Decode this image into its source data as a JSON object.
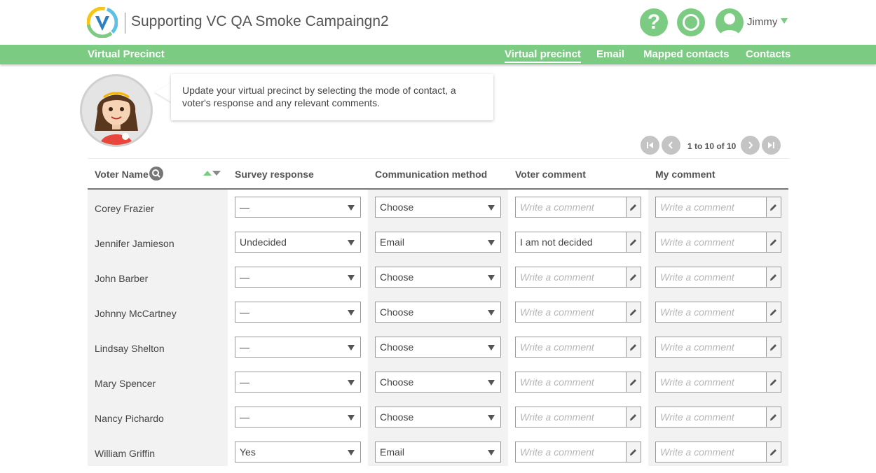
{
  "header": {
    "title": "Supporting VC QA Smoke Campaingn2",
    "help_symbol": "?",
    "user_name": "Jimmy",
    "logo_icon": "v-logo-icon",
    "colors": {
      "accent": "#7ccb83",
      "text": "#555555"
    }
  },
  "nav": {
    "brand": "Virtual Precinct",
    "links": [
      {
        "label": "Virtual precinct",
        "active": true
      },
      {
        "label": "Email",
        "active": false
      },
      {
        "label": "Mapped contacts",
        "active": false
      },
      {
        "label": "Contacts",
        "active": false
      }
    ]
  },
  "tip": {
    "text": "Update your virtual precinct by selecting the mode of contact, a voter's response and any relevant comments."
  },
  "pagination": {
    "summary": "1 to 10 of 10",
    "buttons": [
      "first-page-icon",
      "prev-page-icon",
      "next-page-icon",
      "last-page-icon"
    ]
  },
  "table": {
    "columns": [
      "Voter Name",
      "Survey response",
      "Communication method",
      "Voter comment",
      "My comment"
    ],
    "comment_placeholder": "Write a comment",
    "rows": [
      {
        "name": "Corey Frazier",
        "survey": "—",
        "method": "Choose",
        "voter_comment": "",
        "my_comment": ""
      },
      {
        "name": "Jennifer Jamieson",
        "survey": "Undecided",
        "method": "Email",
        "voter_comment": "I am not decided",
        "my_comment": ""
      },
      {
        "name": "John Barber",
        "survey": "—",
        "method": "Choose",
        "voter_comment": "",
        "my_comment": ""
      },
      {
        "name": "Johnny McCartney",
        "survey": "—",
        "method": "Choose",
        "voter_comment": "",
        "my_comment": ""
      },
      {
        "name": "Lindsay Shelton",
        "survey": "—",
        "method": "Choose",
        "voter_comment": "",
        "my_comment": ""
      },
      {
        "name": "Mary Spencer",
        "survey": "—",
        "method": "Choose",
        "voter_comment": "",
        "my_comment": ""
      },
      {
        "name": "Nancy Pichardo",
        "survey": "—",
        "method": "Choose",
        "voter_comment": "",
        "my_comment": ""
      },
      {
        "name": "William Griffin",
        "survey": "Yes",
        "method": "Email",
        "voter_comment": "",
        "my_comment": ""
      }
    ]
  }
}
